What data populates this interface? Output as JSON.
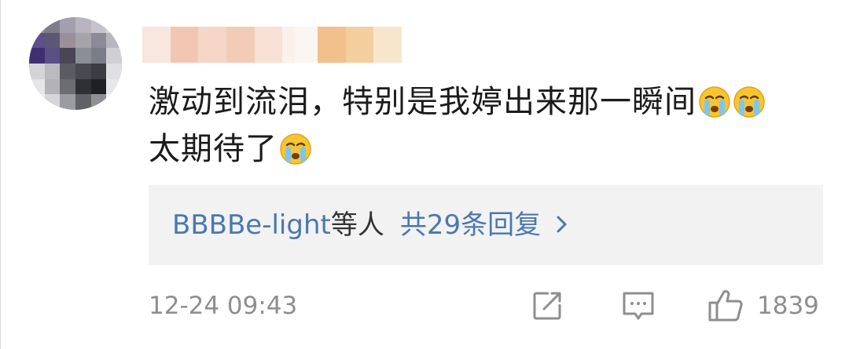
{
  "comment": {
    "text_line1": "激动到流泪，特别是我婷出来那一瞬间",
    "text_line2": "太期待了",
    "emoji_name": "crying-face-icon"
  },
  "replies": {
    "names": "BBBBe-light",
    "suffix": "等人",
    "count_text": "共29条回复"
  },
  "footer": {
    "timestamp": "12-24 09:43",
    "like_count": "1839"
  },
  "colors": {
    "link": "#4a78ad",
    "text": "#1b1b1b",
    "muted": "#8e8e8e",
    "reply_bg": "#f2f2f2"
  }
}
